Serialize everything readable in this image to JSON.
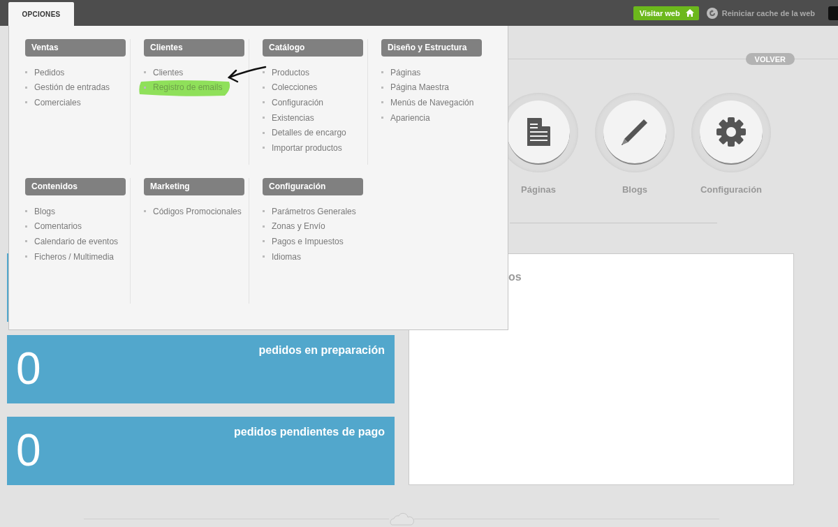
{
  "header": {
    "menu_tab": {
      "label": "OPCIONES",
      "open": true
    },
    "visit_button": "Visitar web",
    "cache_link": "Reiniciar cache de la web"
  },
  "back_button": "VOLVER",
  "shortcuts": [
    {
      "kind": "page",
      "label": "Páginas"
    },
    {
      "kind": "pencil",
      "label": "Blogs"
    },
    {
      "kind": "gear",
      "label": "Configuración"
    }
  ],
  "stat_cards": [
    {
      "value": "0",
      "title": "pedidos en preparación"
    },
    {
      "value": "0",
      "title": "pedidos pendientes de pago"
    }
  ],
  "panel": {
    "title": "os"
  },
  "menu": {
    "sections": [
      {
        "title": "Ventas",
        "items": [
          {
            "label": "Pedidos",
            "highlighted": false
          },
          {
            "label": "Gestión de entradas",
            "highlighted": false
          },
          {
            "label": "Comerciales",
            "highlighted": false
          }
        ]
      },
      {
        "title": "Clientes",
        "items": [
          {
            "label": "Clientes",
            "highlighted": false
          },
          {
            "label": "Registro de emails",
            "highlighted": true
          }
        ]
      },
      {
        "title": "Catálogo",
        "items": [
          {
            "label": "Productos",
            "highlighted": false
          },
          {
            "label": "Colecciones",
            "highlighted": false
          },
          {
            "label": "Configuración",
            "highlighted": false
          },
          {
            "label": "Existencias",
            "highlighted": false
          },
          {
            "label": "Detalles de encargo",
            "highlighted": false
          },
          {
            "label": "Importar productos",
            "highlighted": false
          }
        ]
      },
      {
        "title": "Diseño y Estructura",
        "items": [
          {
            "label": "Páginas",
            "highlighted": false
          },
          {
            "label": "Página Maestra",
            "highlighted": false
          },
          {
            "label": "Menús de Navegación",
            "highlighted": false
          },
          {
            "label": "Apariencia",
            "highlighted": false
          }
        ]
      },
      {
        "title": "Contenidos",
        "items": [
          {
            "label": "Blogs",
            "highlighted": false
          },
          {
            "label": "Comentarios",
            "highlighted": false
          },
          {
            "label": "Calendario de eventos",
            "highlighted": false
          },
          {
            "label": "Ficheros / Multimedia",
            "highlighted": false
          }
        ]
      },
      {
        "title": "Marketing",
        "items": [
          {
            "label": "Códigos Promocionales",
            "highlighted": false
          }
        ]
      },
      {
        "title": "Configuración",
        "items": [
          {
            "label": "Parámetros Generales",
            "highlighted": false
          },
          {
            "label": "Zonas y Envío",
            "highlighted": false
          },
          {
            "label": "Pagos e Impuestos",
            "highlighted": false
          },
          {
            "label": "Idiomas",
            "highlighted": false
          }
        ]
      }
    ]
  }
}
